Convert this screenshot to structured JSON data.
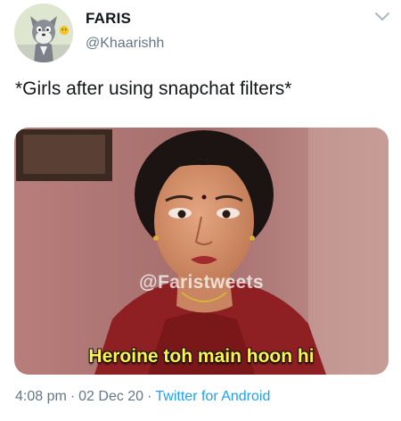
{
  "author": {
    "display_name": "FARIS",
    "handle": "@Khaarishh",
    "avatar_icon": "tom-cat-avatar-icon"
  },
  "more_icon": "chevron-down-icon",
  "tweet": {
    "text": "*Girls after using snapchat filters*",
    "media": {
      "watermark": "@Faristweets",
      "subtitle": "Heroine toh main hoon hi"
    }
  },
  "meta": {
    "time": "4:08 pm",
    "date": "02 Dec 20",
    "separator": "·",
    "source": "Twitter for Android"
  },
  "colors": {
    "text": "#14171a",
    "secondary": "#657786",
    "link": "#1da1f2",
    "subtitle": "#fff34a"
  }
}
